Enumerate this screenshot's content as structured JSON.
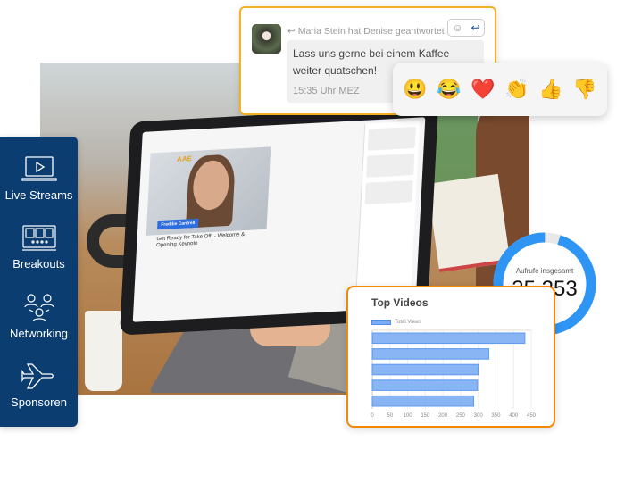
{
  "sidebar": {
    "items": [
      {
        "label": "Live Streams",
        "icon": "laptop-play-icon"
      },
      {
        "label": "Breakouts",
        "icon": "video-grid-icon"
      },
      {
        "label": "Networking",
        "icon": "people-network-icon"
      },
      {
        "label": "Sponsoren",
        "icon": "airplane-icon"
      }
    ]
  },
  "laptop": {
    "speaker_name": "Freddie Cantrell",
    "session_title": "Get Ready for Take Off! - Welcome & Opening Keynote",
    "logo": "AAE"
  },
  "chat": {
    "meta": "Maria Stein hat Denise geantwortet",
    "message": "Lass uns gerne bei einem Kaffee weiter quatschen!",
    "time": "15:35 Uhr MEZ",
    "reply_icon": "reply-icon",
    "emoji_icon": "smiley-icon"
  },
  "reactions": [
    "😃",
    "😂",
    "❤️",
    "👏",
    "👍",
    "👎"
  ],
  "total_views": {
    "label": "Aufrufe insgesamt",
    "value": "35.253",
    "ring_fraction": 0.95,
    "color": "#2e95f5"
  },
  "chart_data": {
    "type": "bar",
    "orientation": "horizontal",
    "title": "Top Videos",
    "series": [
      {
        "name": "Total Views",
        "values": [
          432,
          330,
          300,
          298,
          287
        ]
      }
    ],
    "xlim": [
      0,
      450
    ],
    "xticks": [
      0,
      50,
      100,
      150,
      200,
      250,
      300,
      350,
      400,
      450
    ],
    "grid": true,
    "legend": "top-left",
    "color": "#7eadf5"
  },
  "colors": {
    "sidebar": "#0b3d70",
    "chat_border": "#f3b221",
    "chart_border": "#f0880a"
  }
}
